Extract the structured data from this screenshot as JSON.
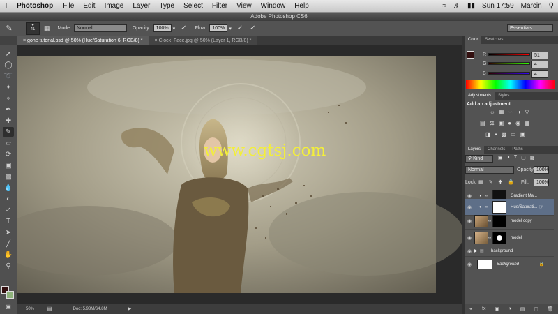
{
  "menubar": {
    "apple": "",
    "app": "Photoshop",
    "items": [
      "File",
      "Edit",
      "Image",
      "Layer",
      "Type",
      "Select",
      "Filter",
      "View",
      "Window",
      "Help"
    ],
    "time": "Sun 17:59",
    "user": "Marcin"
  },
  "window_title": "Adobe Photoshop CS6",
  "options": {
    "brush_size": "41",
    "mode_label": "Mode:",
    "mode_value": "Normal",
    "opacity_label": "Opacity:",
    "opacity_value": "100%",
    "flow_label": "Flow:",
    "flow_value": "100%",
    "workspace": "Essentials"
  },
  "tabs": [
    {
      "label": "gone tutorial.psd @ 50% (Hue/Saturation 6, RGB/8) *",
      "active": true
    },
    {
      "label": "Clock_Face.jpg @ 50% (Layer 1, RGB/8) *",
      "active": false
    }
  ],
  "watermark": "www.cgtsj.com",
  "status": {
    "zoom": "50%",
    "doc": "Doc: 5.93M/64.8M"
  },
  "color_panel": {
    "tabs": [
      "Color",
      "Swatches"
    ],
    "R": "51",
    "G": "4",
    "B": "4"
  },
  "adjustments": {
    "tabs": [
      "Adjustments",
      "Styles"
    ],
    "title": "Add an adjustment"
  },
  "layers_panel": {
    "tabs": [
      "Layers",
      "Channels",
      "Paths"
    ],
    "kind": "Kind",
    "blend": "Normal",
    "opacity_label": "Opacity:",
    "opacity_value": "100%",
    "lock_label": "Lock:",
    "fill_label": "Fill:",
    "fill_value": "100%",
    "layers": [
      "Gradient Ma...",
      "Hue/Saturati...",
      "model copy",
      "model",
      "background",
      "Background"
    ]
  }
}
